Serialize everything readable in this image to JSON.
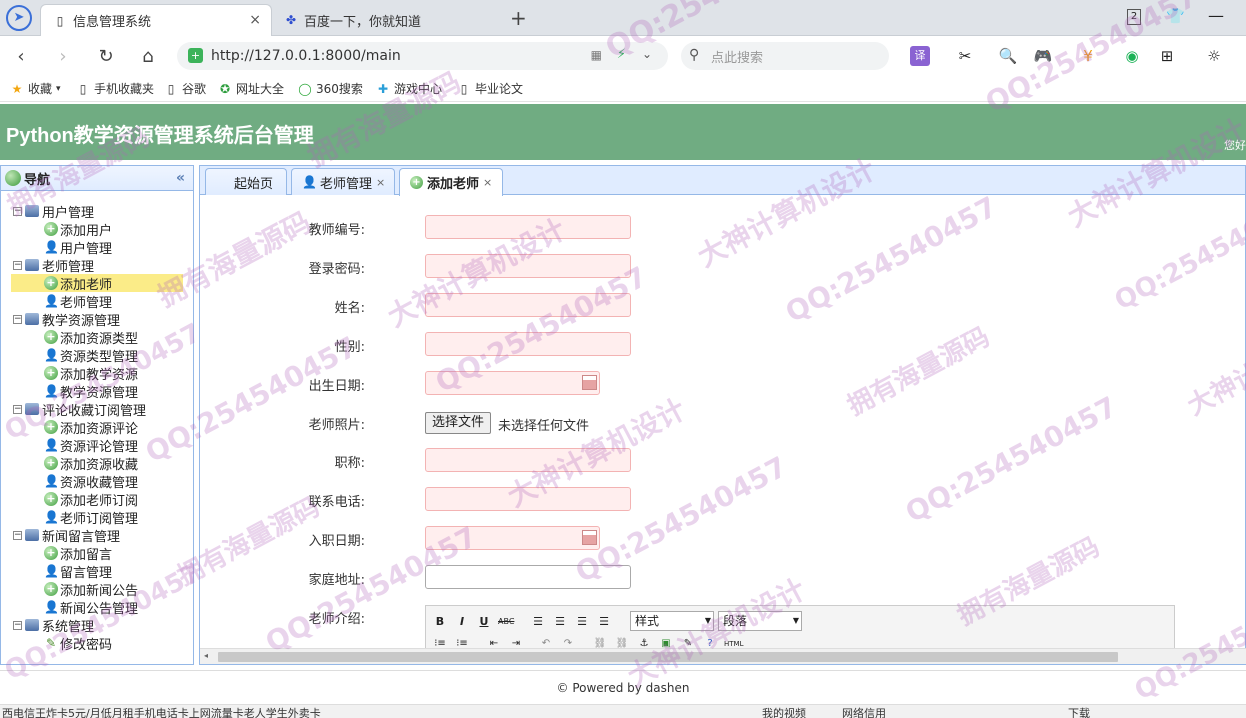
{
  "browser": {
    "tabs": [
      {
        "title": "信息管理系统",
        "icon": "document-icon",
        "active": true
      },
      {
        "title": "百度一下，你就知道",
        "icon": "baidu-paw-icon",
        "active": false
      }
    ],
    "tab_count": "2",
    "url": "http://127.0.0.1:8000/main",
    "search_placeholder": "点此搜索",
    "bookmarks": [
      "收藏",
      "手机收藏夹",
      "谷歌",
      "网址大全",
      "360搜索",
      "游戏中心",
      "毕业论文"
    ]
  },
  "app": {
    "title": "Python教学资源管理系统后台管理",
    "header_right": "您好"
  },
  "nav": {
    "title": "导航",
    "groups": [
      {
        "label": "用户管理",
        "items": [
          {
            "label": "添加用户",
            "type": "add"
          },
          {
            "label": "用户管理",
            "type": "user"
          }
        ]
      },
      {
        "label": "老师管理",
        "items": [
          {
            "label": "添加老师",
            "type": "add",
            "selected": true
          },
          {
            "label": "老师管理",
            "type": "user"
          }
        ]
      },
      {
        "label": "教学资源管理",
        "items": [
          {
            "label": "添加资源类型",
            "type": "add"
          },
          {
            "label": "资源类型管理",
            "type": "user"
          },
          {
            "label": "添加教学资源",
            "type": "add"
          },
          {
            "label": "教学资源管理",
            "type": "user"
          }
        ]
      },
      {
        "label": "评论收藏订阅管理",
        "items": [
          {
            "label": "添加资源评论",
            "type": "add"
          },
          {
            "label": "资源评论管理",
            "type": "user"
          },
          {
            "label": "添加资源收藏",
            "type": "add"
          },
          {
            "label": "资源收藏管理",
            "type": "user"
          },
          {
            "label": "添加老师订阅",
            "type": "add"
          },
          {
            "label": "老师订阅管理",
            "type": "user"
          }
        ]
      },
      {
        "label": "新闻留言管理",
        "items": [
          {
            "label": "添加留言",
            "type": "add"
          },
          {
            "label": "留言管理",
            "type": "user"
          },
          {
            "label": "添加新闻公告",
            "type": "add"
          },
          {
            "label": "新闻公告管理",
            "type": "user"
          }
        ]
      },
      {
        "label": "系统管理",
        "items": [
          {
            "label": "修改密码",
            "type": "pencil"
          }
        ]
      }
    ]
  },
  "tabs": [
    {
      "label": "起始页",
      "closable": false
    },
    {
      "label": "老师管理",
      "closable": true
    },
    {
      "label": "添加老师",
      "closable": true,
      "active": true
    }
  ],
  "form": {
    "fields": [
      {
        "label": "教师编号:",
        "type": "text",
        "value": ""
      },
      {
        "label": "登录密码:",
        "type": "text",
        "value": ""
      },
      {
        "label": "姓名:",
        "type": "text",
        "value": ""
      },
      {
        "label": "性别:",
        "type": "text",
        "value": ""
      },
      {
        "label": "出生日期:",
        "type": "date",
        "value": ""
      },
      {
        "label": "老师照片:",
        "type": "file",
        "button": "选择文件",
        "status": "未选择任何文件"
      },
      {
        "label": "职称:",
        "type": "text",
        "value": ""
      },
      {
        "label": "联系电话:",
        "type": "text",
        "value": ""
      },
      {
        "label": "入职日期:",
        "type": "date",
        "value": ""
      },
      {
        "label": "家庭地址:",
        "type": "plain",
        "value": ""
      },
      {
        "label": "老师介绍:",
        "type": "editor"
      }
    ],
    "editor": {
      "style_select": "样式",
      "format_select": "段落"
    }
  },
  "footer": "© Powered by dashen",
  "statusbar": {
    "left": "西电信王炸卡5元/月低月租手机电话卡上网流量卡老人学生外卖卡",
    "right": [
      "我的视频",
      "网络信用",
      "下载"
    ]
  },
  "watermarks": [
    "QQ:254540457",
    "大神计算机设计",
    "拥有海量源码"
  ]
}
